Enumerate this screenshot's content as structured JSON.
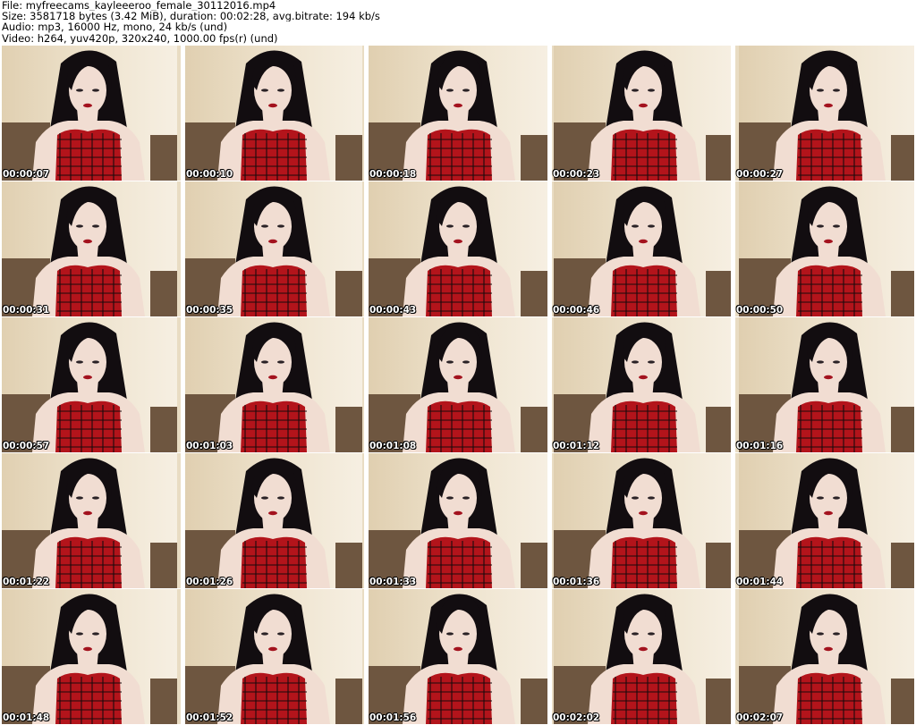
{
  "header": {
    "file": "File: myfreecams_kayleeeroo_female_30112016.mp4",
    "size": "Size: 3581718 bytes (3.42 MiB), duration: 00:02:28, avg.bitrate: 194 kb/s",
    "audio": "Audio: mp3, 16000 Hz, mono, 24 kb/s (und)",
    "video": "Video: h264, yuv420p, 320x240, 1000.00 fps(r) (und)"
  },
  "thumbnails": [
    {
      "timestamp": "00:00:07"
    },
    {
      "timestamp": "00:00:10"
    },
    {
      "timestamp": "00:00:18"
    },
    {
      "timestamp": "00:00:23"
    },
    {
      "timestamp": "00:00:27"
    },
    {
      "timestamp": "00:00:31"
    },
    {
      "timestamp": "00:00:35"
    },
    {
      "timestamp": "00:00:43"
    },
    {
      "timestamp": "00:00:46"
    },
    {
      "timestamp": "00:00:50"
    },
    {
      "timestamp": "00:00:57"
    },
    {
      "timestamp": "00:01:03"
    },
    {
      "timestamp": "00:01:08"
    },
    {
      "timestamp": "00:01:12"
    },
    {
      "timestamp": "00:01:16"
    },
    {
      "timestamp": "00:01:22"
    },
    {
      "timestamp": "00:01:26"
    },
    {
      "timestamp": "00:01:33"
    },
    {
      "timestamp": "00:01:36"
    },
    {
      "timestamp": "00:01:44"
    },
    {
      "timestamp": "00:01:48"
    },
    {
      "timestamp": "00:01:52"
    },
    {
      "timestamp": "00:01:56"
    },
    {
      "timestamp": "00:02:02"
    },
    {
      "timestamp": "00:02:07"
    }
  ],
  "colors": {
    "wall": "#e6d7bb",
    "sofa": "#6e5640",
    "hair": "#120d10",
    "skin": "#f1ddd2",
    "shirt": "#b3141b",
    "lips": "#a3121e"
  }
}
